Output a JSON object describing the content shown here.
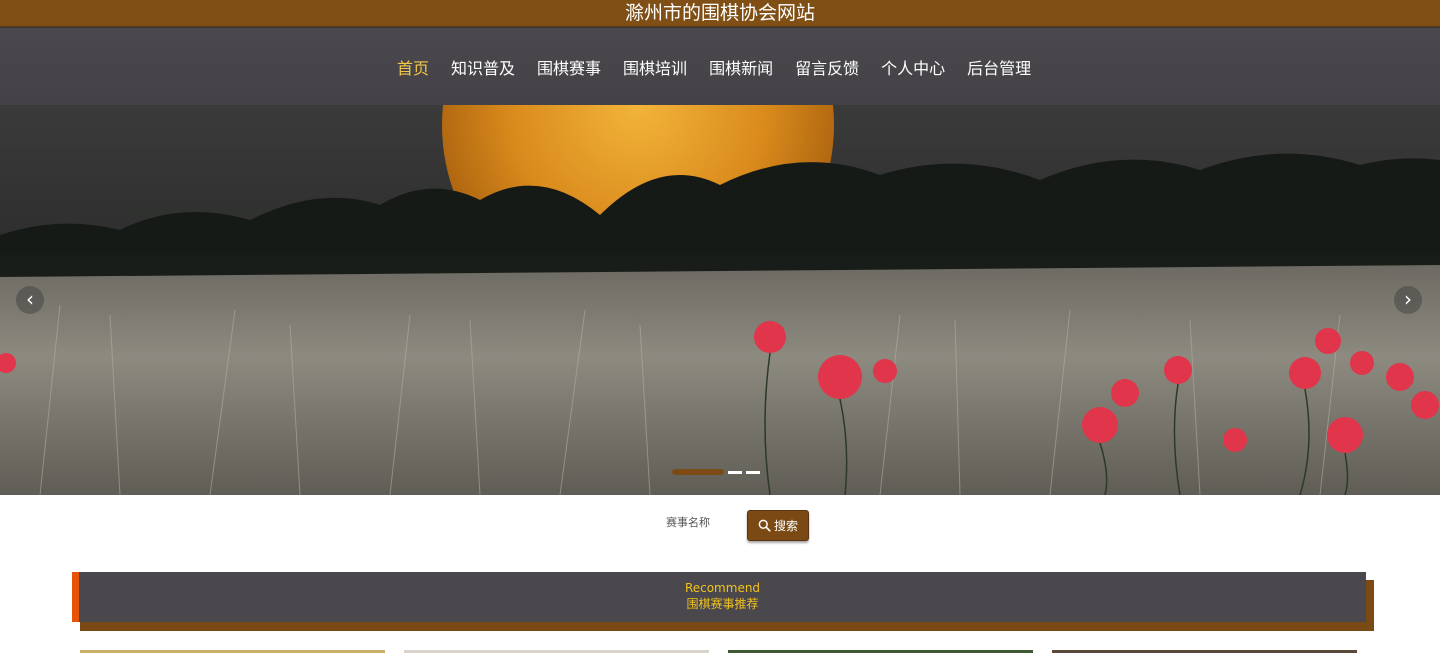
{
  "site": {
    "title": "滁州市的围棋协会网站"
  },
  "nav": {
    "items": [
      {
        "label": "首页",
        "active": true
      },
      {
        "label": "知识普及",
        "active": false
      },
      {
        "label": "围棋赛事",
        "active": false
      },
      {
        "label": "围棋培训",
        "active": false
      },
      {
        "label": "围棋新闻",
        "active": false
      },
      {
        "label": "留言反馈",
        "active": false
      },
      {
        "label": "个人中心",
        "active": false
      },
      {
        "label": "后台管理",
        "active": false
      }
    ]
  },
  "carousel": {
    "prev_icon": "chevron-left-icon",
    "next_icon": "chevron-right-icon",
    "prev_symbol": "‹",
    "next_symbol": "›",
    "slide_count": 3,
    "active_index": 0
  },
  "search": {
    "label": "赛事名称",
    "button_label": "搜索",
    "button_icon": "search-icon"
  },
  "recommend": {
    "subtitle": "Recommend",
    "title": "围棋赛事推荐"
  },
  "colors": {
    "brand_brown": "#7f4f16",
    "nav_bg": "#4a484c",
    "nav_active": "#f2c74a",
    "accent_orange": "#e6540a",
    "section_text": "#f2c21c"
  }
}
